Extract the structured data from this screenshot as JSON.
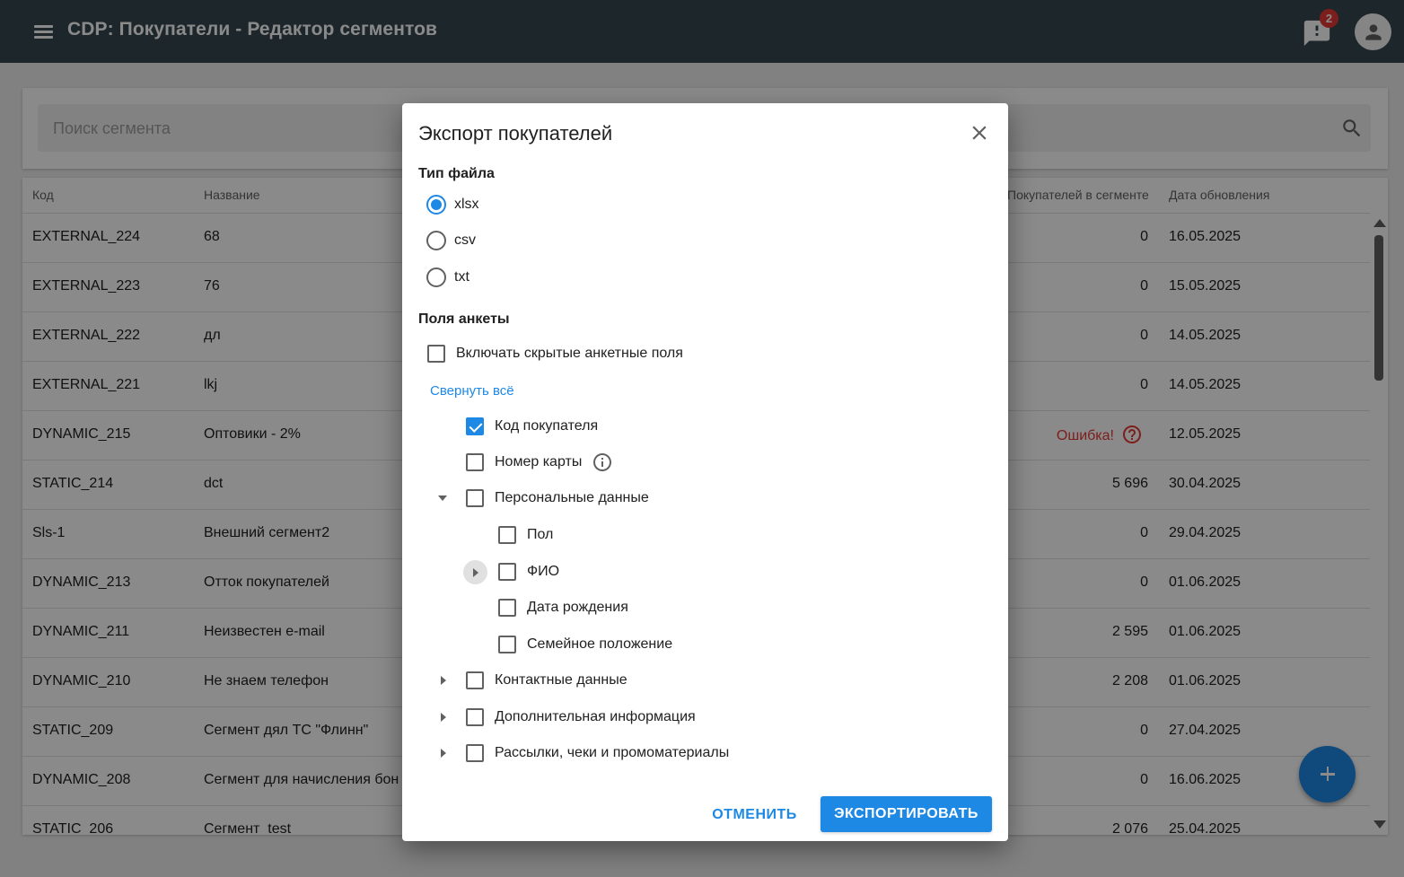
{
  "app": {
    "title": "CDP: Покупатели - Редактор сегментов",
    "notification_count": "2"
  },
  "search": {
    "placeholder": "Поиск сегмента"
  },
  "table": {
    "columns": {
      "code": "Код",
      "name": "Название",
      "count": "Покупателей в сегменте",
      "date": "Дата обновления"
    },
    "rows": [
      {
        "code": "EXTERNAL_224",
        "name": "68",
        "count": "0",
        "date": "16.05.2025"
      },
      {
        "code": "EXTERNAL_223",
        "name": "76",
        "count": "0",
        "date": "15.05.2025"
      },
      {
        "code": "EXTERNAL_222",
        "name": "дл",
        "count": "0",
        "date": "14.05.2025"
      },
      {
        "code": "EXTERNAL_221",
        "name": "lkj",
        "count": "0",
        "date": "14.05.2025"
      },
      {
        "code": "DYNAMIC_215",
        "name": "Оптовики - 2%",
        "count": "Ошибка!",
        "error": true,
        "date": "12.05.2025"
      },
      {
        "code": "STATIC_214",
        "name": "dct",
        "count": "5 696",
        "date": "30.04.2025"
      },
      {
        "code": "Sls-1",
        "name": "Внешний сегмент2",
        "count": "0",
        "date": "29.04.2025"
      },
      {
        "code": "DYNAMIC_213",
        "name": "Отток покупателей",
        "count": "0",
        "date": "01.06.2025"
      },
      {
        "code": "DYNAMIC_211",
        "name": "Неизвестен e-mail",
        "count": "2 595",
        "date": "01.06.2025"
      },
      {
        "code": "DYNAMIC_210",
        "name": "Не знаем телефон",
        "count": "2 208",
        "date": "01.06.2025"
      },
      {
        "code": "STATIC_209",
        "name": "Сегмент дял ТС \"Флинн\"",
        "count": "0",
        "date": "27.04.2025"
      },
      {
        "code": "DYNAMIC_208",
        "name": "Сегмент для начисления бон",
        "count": "0",
        "date": "16.06.2025"
      },
      {
        "code": "STATIC_206",
        "name": "Сегмент_test",
        "count": "2 076",
        "date": "25.04.2025"
      }
    ]
  },
  "dialog": {
    "title": "Экспорт покупателей",
    "file_type_label": "Тип файла",
    "file_types": [
      {
        "label": "xlsx",
        "selected": true
      },
      {
        "label": "csv",
        "selected": false
      },
      {
        "label": "txt",
        "selected": false
      }
    ],
    "fields_label": "Поля анкеты",
    "include_hidden_label": "Включать скрытые анкетные поля",
    "collapse_all": "Свернуть всё",
    "tree": {
      "customer_code": "Код покупателя",
      "card_number": "Номер карты",
      "personal_data": "Персональные данные",
      "gender": "Пол",
      "full_name": "ФИО",
      "birth_date": "Дата рождения",
      "marital_status": "Семейное положение",
      "contact_data": "Контактные данные",
      "additional_info": "Дополнительная информация",
      "mailings": "Рассылки, чеки и промоматериалы"
    },
    "cancel_label": "ОТМЕНИТЬ",
    "export_label": "ЭКСПОРТИРОВАТЬ"
  },
  "colors": {
    "appbar": "#37474f",
    "accent": "#1e88e5",
    "error": "#e53935"
  }
}
